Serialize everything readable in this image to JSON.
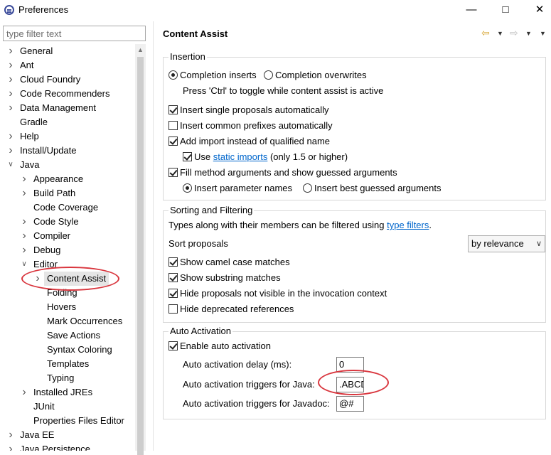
{
  "window": {
    "title": "Preferences",
    "min": "—",
    "max": "□",
    "close": "✕"
  },
  "filter": {
    "placeholder": "type filter text"
  },
  "tree": {
    "general": "General",
    "ant": "Ant",
    "cloud_foundry": "Cloud Foundry",
    "code_recommenders": "Code Recommenders",
    "data_management": "Data Management",
    "gradle": "Gradle",
    "help": "Help",
    "install_update": "Install/Update",
    "java": "Java",
    "appearance": "Appearance",
    "build_path": "Build Path",
    "code_coverage": "Code Coverage",
    "code_style": "Code Style",
    "compiler": "Compiler",
    "debug": "Debug",
    "editor": "Editor",
    "content_assist": "Content Assist",
    "folding": "Folding",
    "hovers": "Hovers",
    "mark_occurrences": "Mark Occurrences",
    "save_actions": "Save Actions",
    "syntax_coloring": "Syntax Coloring",
    "templates": "Templates",
    "typing": "Typing",
    "installed_jres": "Installed JREs",
    "junit": "JUnit",
    "properties_files_editor": "Properties Files Editor",
    "java_ee": "Java EE",
    "java_persistence": "Java Persistence"
  },
  "page": {
    "title": "Content Assist"
  },
  "insertion": {
    "label": "Insertion",
    "completion_inserts": "Completion inserts",
    "completion_overwrites": "Completion overwrites",
    "toggle_hint": "Press 'Ctrl' to toggle while content assist is active",
    "single_proposals": "Insert single proposals automatically",
    "common_prefixes": "Insert common prefixes automatically",
    "add_import": "Add import instead of qualified name",
    "use": "Use",
    "static_imports": "static imports",
    "only_15": "(only 1.5 or higher)",
    "fill_args": "Fill method arguments and show guessed arguments",
    "insert_param_names": "Insert parameter names",
    "insert_best_guessed": "Insert best guessed arguments"
  },
  "sorting": {
    "label": "Sorting and Filtering",
    "types_text": "Types along with their members can be filtered using",
    "type_filters": "type filters",
    "period": ".",
    "sort_proposals": "Sort proposals",
    "sort_value": "by relevance",
    "camel_case": "Show camel case matches",
    "substring": "Show substring matches",
    "hide_not_visible": "Hide proposals not visible in the invocation context",
    "hide_deprecated": "Hide deprecated references"
  },
  "auto_activation": {
    "label": "Auto Activation",
    "enable": "Enable auto activation",
    "delay_label": "Auto activation delay (ms):",
    "delay_value": "0",
    "java_triggers_label": "Auto activation triggers for Java:",
    "java_triggers_value": ".ABCD",
    "javadoc_triggers_label": "Auto activation triggers for Javadoc:",
    "javadoc_triggers_value": "@#"
  },
  "colors": {
    "annotation": "#d9363e",
    "link": "#0066cc",
    "selection": "#e5e5e5"
  }
}
